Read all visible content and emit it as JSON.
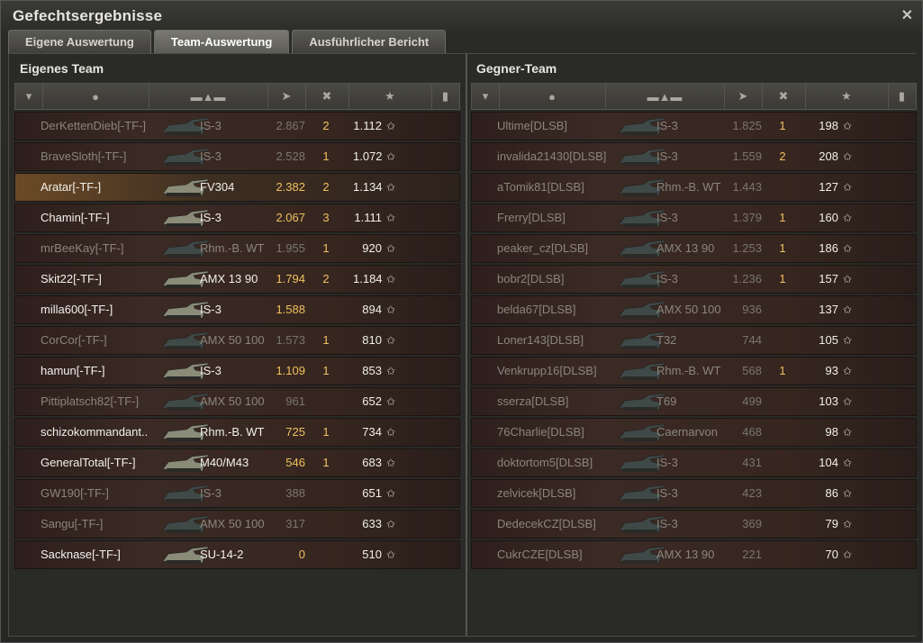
{
  "window": {
    "title": "Gefechtsergebnisse"
  },
  "tabs": [
    {
      "label": "Eigene Auswertung",
      "active": false
    },
    {
      "label": "Team-Auswertung",
      "active": true
    },
    {
      "label": "Ausführlicher Bericht",
      "active": false
    }
  ],
  "teams": {
    "own": {
      "title": "Eigenes Team",
      "rows": [
        {
          "name": "DerKettenDieb[-TF-]",
          "tank": "IS-3",
          "xp": "2.867",
          "kills": "2",
          "score": "1.112",
          "alive": false
        },
        {
          "name": "BraveSloth[-TF-]",
          "tank": "IS-3",
          "xp": "2.528",
          "kills": "1",
          "score": "1.072",
          "alive": false
        },
        {
          "name": "Aratar[-TF-]",
          "tank": "FV304",
          "xp": "2.382",
          "kills": "2",
          "score": "1.134",
          "alive": true,
          "highlight": true
        },
        {
          "name": "Chamin[-TF-]",
          "tank": "IS-3",
          "xp": "2.067",
          "kills": "3",
          "score": "1.111",
          "alive": true
        },
        {
          "name": "mrBeeKay[-TF-]",
          "tank": "Rhm.-B. WT",
          "xp": "1.955",
          "kills": "1",
          "score": "920",
          "alive": false
        },
        {
          "name": "Skit22[-TF-]",
          "tank": "AMX 13 90",
          "xp": "1.794",
          "kills": "2",
          "score": "1.184",
          "alive": true
        },
        {
          "name": "milla600[-TF-]",
          "tank": "IS-3",
          "xp": "1.588",
          "kills": "",
          "score": "894",
          "alive": true
        },
        {
          "name": "CorCor[-TF-]",
          "tank": "AMX 50 100",
          "xp": "1.573",
          "kills": "1",
          "score": "810",
          "alive": false
        },
        {
          "name": "hamun[-TF-]",
          "tank": "IS-3",
          "xp": "1.109",
          "kills": "1",
          "score": "853",
          "alive": true
        },
        {
          "name": "Pittiplatsch82[-TF-]",
          "tank": "AMX 50 100",
          "xp": "961",
          "kills": "",
          "score": "652",
          "alive": false
        },
        {
          "name": "schizokommandant..",
          "tank": "Rhm.-B. WT",
          "xp": "725",
          "kills": "1",
          "score": "734",
          "alive": true
        },
        {
          "name": "GeneralTotal[-TF-]",
          "tank": "M40/M43",
          "xp": "546",
          "kills": "1",
          "score": "683",
          "alive": true
        },
        {
          "name": "GW190[-TF-]",
          "tank": "IS-3",
          "xp": "388",
          "kills": "",
          "score": "651",
          "alive": false
        },
        {
          "name": "Sangu[-TF-]",
          "tank": "AMX 50 100",
          "xp": "317",
          "kills": "",
          "score": "633",
          "alive": false
        },
        {
          "name": "Sacknase[-TF-]",
          "tank": "SU-14-2",
          "xp": "0",
          "kills": "",
          "score": "510",
          "alive": true
        }
      ]
    },
    "enemy": {
      "title": "Gegner-Team",
      "rows": [
        {
          "name": "Ultime[DLSB]",
          "tank": "IS-3",
          "xp": "1.825",
          "kills": "1",
          "score": "198",
          "alive": false
        },
        {
          "name": "invalida21430[DLSB]",
          "tank": "IS-3",
          "xp": "1.559",
          "kills": "2",
          "score": "208",
          "alive": false
        },
        {
          "name": "aTomik81[DLSB]",
          "tank": "Rhm.-B. WT",
          "xp": "1.443",
          "kills": "",
          "score": "127",
          "alive": false
        },
        {
          "name": "Frerry[DLSB]",
          "tank": "IS-3",
          "xp": "1.379",
          "kills": "1",
          "score": "160",
          "alive": false
        },
        {
          "name": "peaker_cz[DLSB]",
          "tank": "AMX 13 90",
          "xp": "1.253",
          "kills": "1",
          "score": "186",
          "alive": false
        },
        {
          "name": "bobr2[DLSB]",
          "tank": "IS-3",
          "xp": "1.236",
          "kills": "1",
          "score": "157",
          "alive": false
        },
        {
          "name": "belda67[DLSB]",
          "tank": "AMX 50 100",
          "xp": "936",
          "kills": "",
          "score": "137",
          "alive": false
        },
        {
          "name": "Loner143[DLSB]",
          "tank": "T32",
          "xp": "744",
          "kills": "",
          "score": "105",
          "alive": false
        },
        {
          "name": "Venkrupp16[DLSB]",
          "tank": "Rhm.-B. WT",
          "xp": "568",
          "kills": "1",
          "score": "93",
          "alive": false
        },
        {
          "name": "sserza[DLSB]",
          "tank": "T69",
          "xp": "499",
          "kills": "",
          "score": "103",
          "alive": false
        },
        {
          "name": "76Charlie[DLSB]",
          "tank": "Caernarvon",
          "xp": "468",
          "kills": "",
          "score": "98",
          "alive": false
        },
        {
          "name": "doktortom5[DLSB]",
          "tank": "IS-3",
          "xp": "431",
          "kills": "",
          "score": "104",
          "alive": false
        },
        {
          "name": "zelvicek[DLSB]",
          "tank": "IS-3",
          "xp": "423",
          "kills": "",
          "score": "86",
          "alive": false
        },
        {
          "name": "DedecekCZ[DLSB]",
          "tank": "IS-3",
          "xp": "369",
          "kills": "",
          "score": "79",
          "alive": false
        },
        {
          "name": "CukrCZE[DLSB]",
          "tank": "AMX 13 90",
          "xp": "221",
          "kills": "",
          "score": "70",
          "alive": false
        }
      ]
    }
  },
  "icons": {
    "close": "close-icon",
    "star": "star-icon",
    "rank": "rank-badge-icon",
    "player": "player-icon",
    "tank": "tank-icon",
    "damage": "damage-icon",
    "kills": "kills-icon",
    "xp": "xp-star-icon",
    "medal": "medal-icon"
  }
}
